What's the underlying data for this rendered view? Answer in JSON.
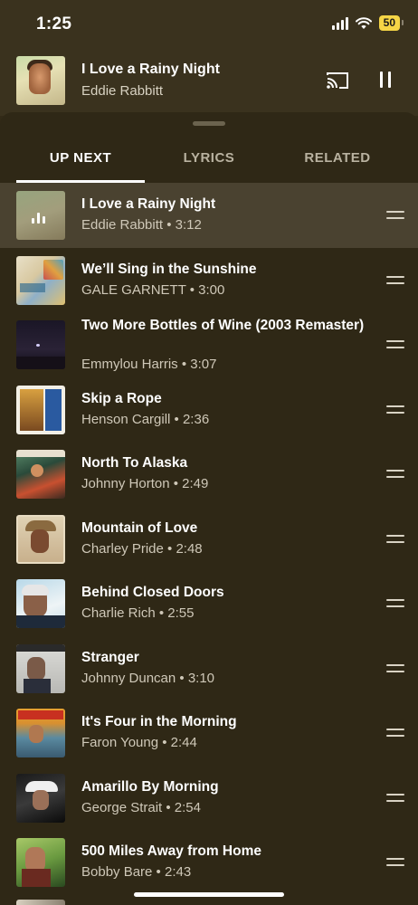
{
  "status": {
    "time": "1:25",
    "battery": "50"
  },
  "now_playing": {
    "title": "I Love a Rainy Night",
    "artist": "Eddie Rabbitt"
  },
  "tabs": [
    {
      "label": "UP NEXT"
    },
    {
      "label": "LYRICS"
    },
    {
      "label": "RELATED"
    }
  ],
  "queue": [
    {
      "title": "I Love a Rainy Night",
      "artist": "Eddie Rabbitt",
      "duration": "3:12",
      "sub": "Eddie Rabbitt • 3:12"
    },
    {
      "title": "We’ll Sing in the Sunshine",
      "artist": "GALE GARNETT",
      "duration": "3:00",
      "sub": "GALE GARNETT • 3:00"
    },
    {
      "title": "Two More Bottles of Wine (2003 Remaster)",
      "artist": "Emmylou Harris",
      "duration": "3:07",
      "sub": "Emmylou Harris • 3:07"
    },
    {
      "title": "Skip a Rope",
      "artist": "Henson Cargill",
      "duration": "2:36",
      "sub": "Henson Cargill • 2:36"
    },
    {
      "title": "North To Alaska",
      "artist": "Johnny Horton",
      "duration": "2:49",
      "sub": "Johnny Horton • 2:49"
    },
    {
      "title": "Mountain of Love",
      "artist": "Charley Pride",
      "duration": "2:48",
      "sub": "Charley Pride • 2:48"
    },
    {
      "title": "Behind Closed Doors",
      "artist": "Charlie Rich",
      "duration": "2:55",
      "sub": "Charlie Rich • 2:55"
    },
    {
      "title": "Stranger",
      "artist": "Johnny Duncan",
      "duration": "3:10",
      "sub": "Johnny Duncan • 3:10"
    },
    {
      "title": "It's Four in the Morning",
      "artist": "Faron Young",
      "duration": "2:44",
      "sub": "Faron Young • 2:44"
    },
    {
      "title": "Amarillo By Morning",
      "artist": "George Strait",
      "duration": "2:54",
      "sub": "George Strait • 2:54"
    },
    {
      "title": "500 Miles Away from Home",
      "artist": "Bobby Bare",
      "duration": "2:43",
      "sub": "Bobby Bare • 2:43"
    }
  ],
  "colors": {
    "background": "#322a17",
    "current_row": "#4a4230",
    "battery": "#f5d546"
  }
}
